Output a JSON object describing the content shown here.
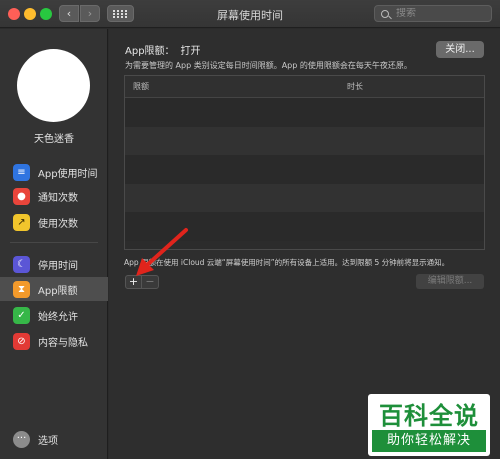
{
  "titlebar": {
    "title": "屏幕使用时间",
    "back_glyph": "‹",
    "forward_glyph": "›",
    "search_placeholder": "搜索"
  },
  "sidebar": {
    "username": "天色迷香",
    "items": [
      {
        "label": "App使用时间",
        "icon": "hourglass-icon",
        "glyph": "≡",
        "color": "#2f74e0"
      },
      {
        "label": "通知次数",
        "icon": "notification-icon",
        "glyph": "●",
        "color": "#e9453b"
      },
      {
        "label": "使用次数",
        "icon": "pickup-icon",
        "glyph": "↗",
        "color": "#f1c52c"
      },
      {
        "label": "停用时间",
        "icon": "downtime-icon",
        "glyph": "☾",
        "color": "#5b56d6"
      },
      {
        "label": "App限额",
        "icon": "app-limits-icon",
        "glyph": "⧗",
        "color": "#f39a2b",
        "selected": true
      },
      {
        "label": "始终允许",
        "icon": "always-allowed-icon",
        "glyph": "✓",
        "color": "#36b748"
      },
      {
        "label": "内容与隐私",
        "icon": "content-privacy-icon",
        "glyph": "⊘",
        "color": "#e23a35"
      }
    ],
    "options_label": "选项",
    "options_glyph": "···"
  },
  "main": {
    "status_label": "App限额：",
    "status_value": "打开",
    "toggle_button": "关闭...",
    "description": "为需要管理的 App 类别设定每日时间限额。App 的使用限额会在每天午夜还原。",
    "table": {
      "columns": [
        "限额",
        "时长"
      ],
      "rows": []
    },
    "note": "App 限额在使用 iCloud 云端“屏幕使用时间”的所有设备上适用。达到限额 5 分钟前将显示通知。",
    "add_glyph": "+",
    "remove_glyph": "−",
    "edit_button": "编辑限额..."
  },
  "watermark": {
    "top": "百科全说",
    "bottom": "助你轻松解决"
  },
  "annotation": {
    "arrow_color": "#e0241c",
    "points_to": "add-limit-button"
  }
}
